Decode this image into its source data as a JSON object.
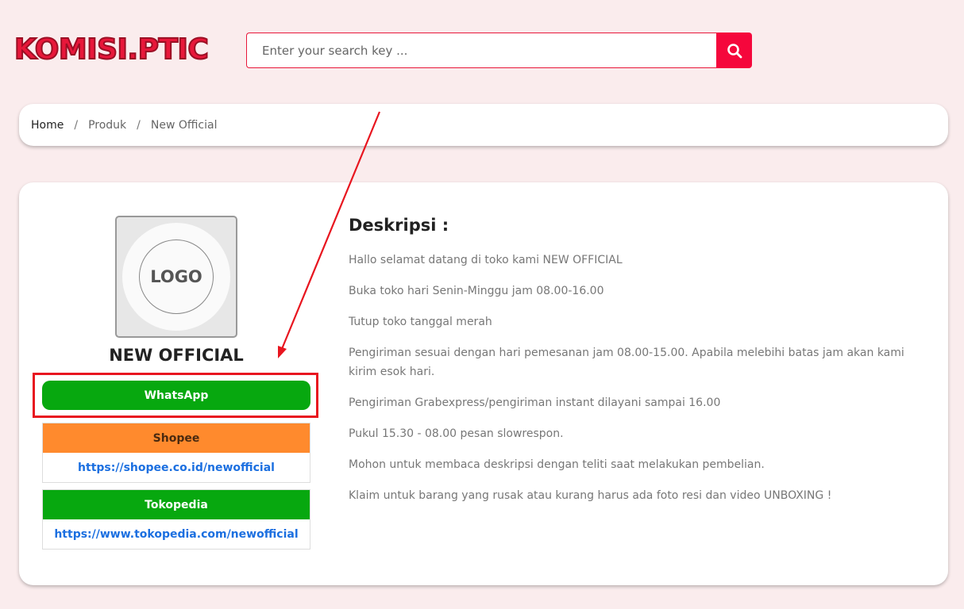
{
  "brand": {
    "name": "KOMISI.PTIC"
  },
  "search": {
    "placeholder": "Enter your search key ...",
    "icon": "search-icon"
  },
  "breadcrumb": {
    "items": [
      "Home",
      "Produk",
      "New Official"
    ],
    "separator": "/"
  },
  "store": {
    "logo_text": "LOGO",
    "name": "NEW OFFICIAL",
    "whatsapp_label": "WhatsApp",
    "marketplaces": [
      {
        "name": "Shopee",
        "url": "https://shopee.co.id/newofficial",
        "color": "#ff8a2d"
      },
      {
        "name": "Tokopedia",
        "url": "https://www.tokopedia.com/newofficial",
        "color": "#07a80f"
      }
    ]
  },
  "description": {
    "title": "Deskripsi :",
    "lines": [
      "Hallo selamat datang di toko kami NEW OFFICIAL",
      "Buka toko hari Senin-Minggu jam 08.00-16.00",
      "Tutup toko tanggal merah",
      "Pengiriman sesuai dengan hari pemesanan jam 08.00-15.00. Apabila melebihi batas jam akan kami kirim esok hari.",
      "Pengiriman Grabexpress/pengiriman instant dilayani sampai 16.00",
      "Pukul 15.30  -  08.00 pesan slowrespon.",
      "Mohon untuk membaca deskripsi dengan teliti saat melakukan pembelian.",
      "Klaim untuk barang yang rusak atau kurang harus ada foto resi dan video UNBOXING !"
    ]
  },
  "colors": {
    "brand": "#e8173a",
    "whatsapp": "#07a80f",
    "annotation": "#e8151f"
  }
}
